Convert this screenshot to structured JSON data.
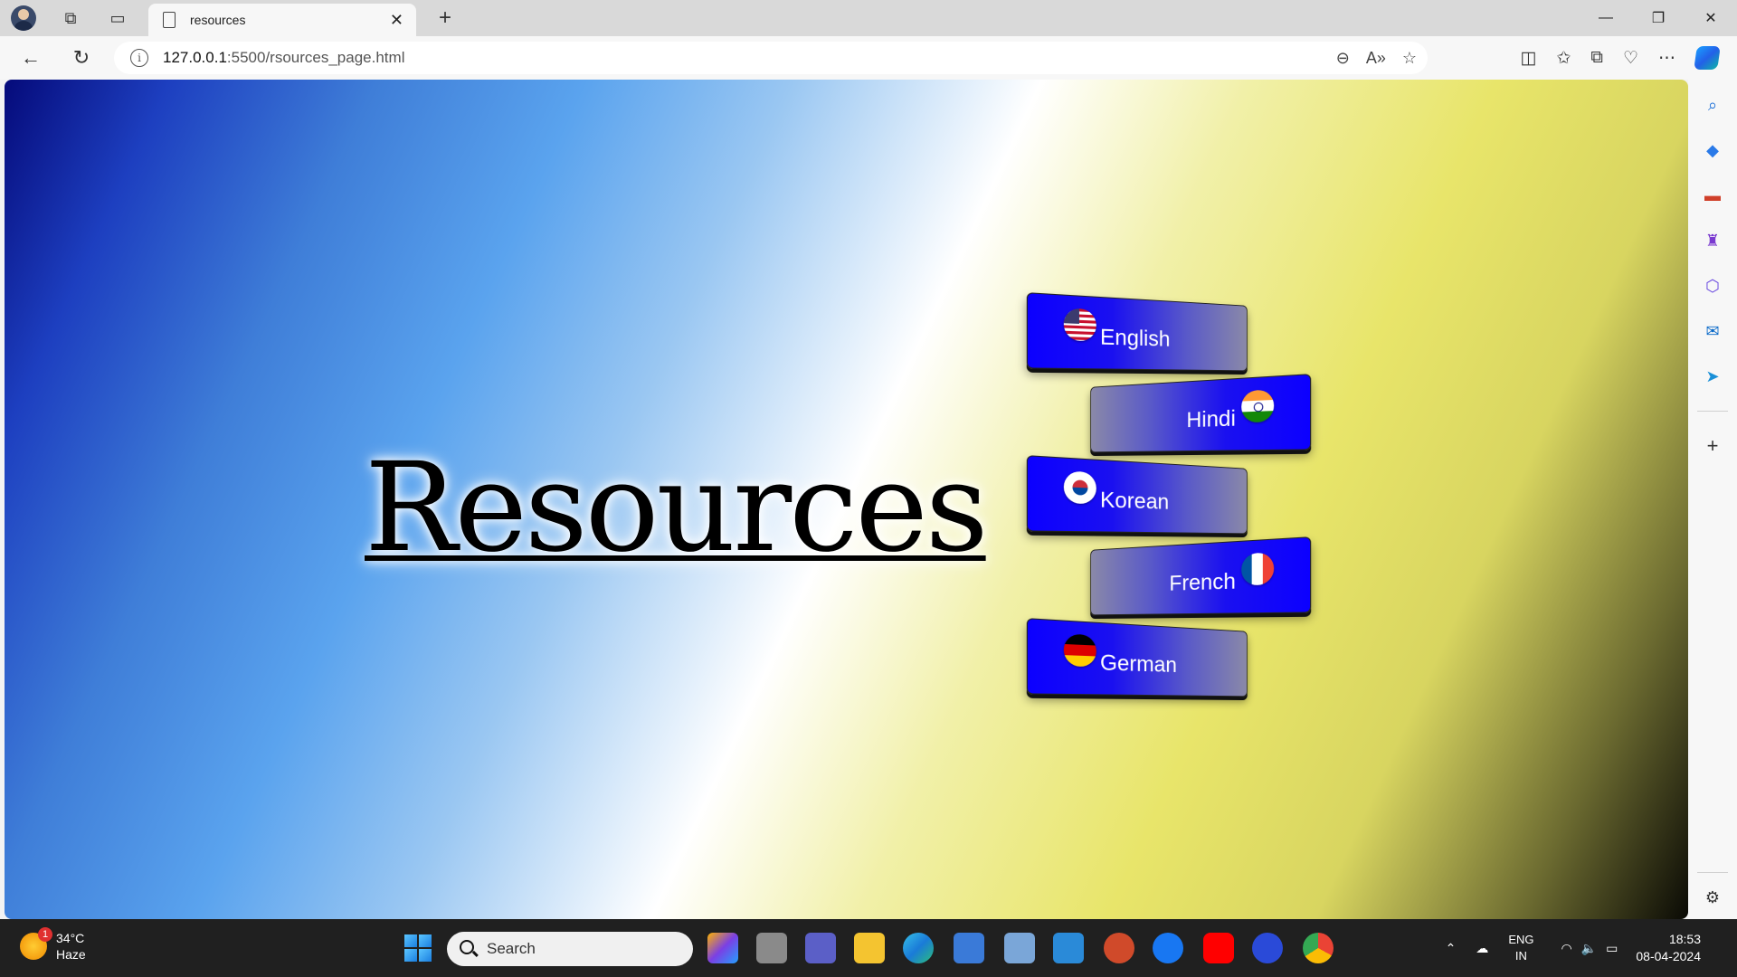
{
  "browser": {
    "tab_title": "resources",
    "url_host": "127.0.0.1",
    "url_path": ":5500/rsources_page.html"
  },
  "page": {
    "heading": "Resources",
    "languages": [
      {
        "label": "English",
        "flag": "us-flag-icon",
        "side": "left"
      },
      {
        "label": "Hindi",
        "flag": "india-flag-icon",
        "side": "right"
      },
      {
        "label": "Korean",
        "flag": "korea-flag-icon",
        "side": "left"
      },
      {
        "label": "French",
        "flag": "france-flag-icon",
        "side": "right"
      },
      {
        "label": "German",
        "flag": "germany-flag-icon",
        "side": "left"
      }
    ]
  },
  "taskbar": {
    "weather_temp": "34°C",
    "weather_desc": "Haze",
    "weather_badge": "1",
    "search_placeholder": "Search",
    "lang_line1": "ENG",
    "lang_line2": "IN",
    "time": "18:53",
    "date": "08-04-2024"
  },
  "colors": {
    "button_blue": "#0c00ff",
    "button_grey": "#8a89a8"
  }
}
